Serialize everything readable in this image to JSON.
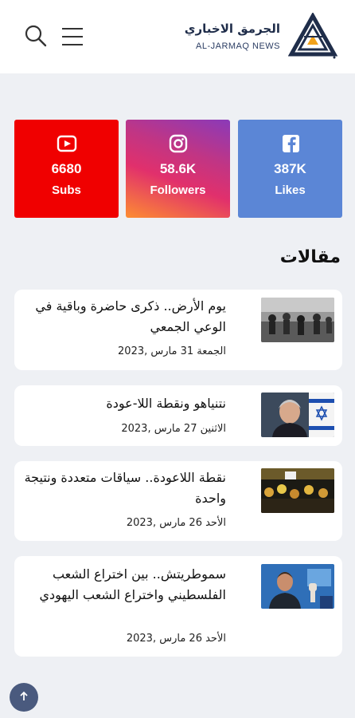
{
  "header": {
    "site_title": "الجرمق الاخباري",
    "site_subtitle": "AL-JARMAQ NEWS",
    "logo_colors": {
      "navy": "#1f2d4a",
      "orange": "#f2a21b"
    }
  },
  "social": [
    {
      "network": "youtube",
      "icon": "youtube-icon",
      "count": "6680",
      "label": "Subs",
      "color": "#f00000"
    },
    {
      "network": "instagram",
      "icon": "instagram-icon",
      "count": "58.6K",
      "label": "Followers",
      "color": "#c13584"
    },
    {
      "network": "facebook",
      "icon": "facebook-icon",
      "count": "387K",
      "label": "Likes",
      "color": "#5b86d6"
    }
  ],
  "section_title": "مقالات",
  "articles": [
    {
      "title": "يوم الأرض.. ذكرى حاضرة وباقية في الوعي الجمعي",
      "date": "الجمعة 31 مارس ,2023"
    },
    {
      "title": "نتنياهو ونقطة اللا-عودة",
      "date": "الاثنين 27 مارس ,2023"
    },
    {
      "title": "نقطة اللاعودة.. سياقات متعددة ونتيجة واحدة",
      "date": "الأحد 26 مارس ,2023"
    },
    {
      "title": "سموطريتش.. بين اختراع الشعب الفلسطيني واختراع الشعب اليهودي",
      "date": "الأحد 26 مارس ,2023"
    }
  ],
  "back_to_top_icon": "arrow-up-icon"
}
